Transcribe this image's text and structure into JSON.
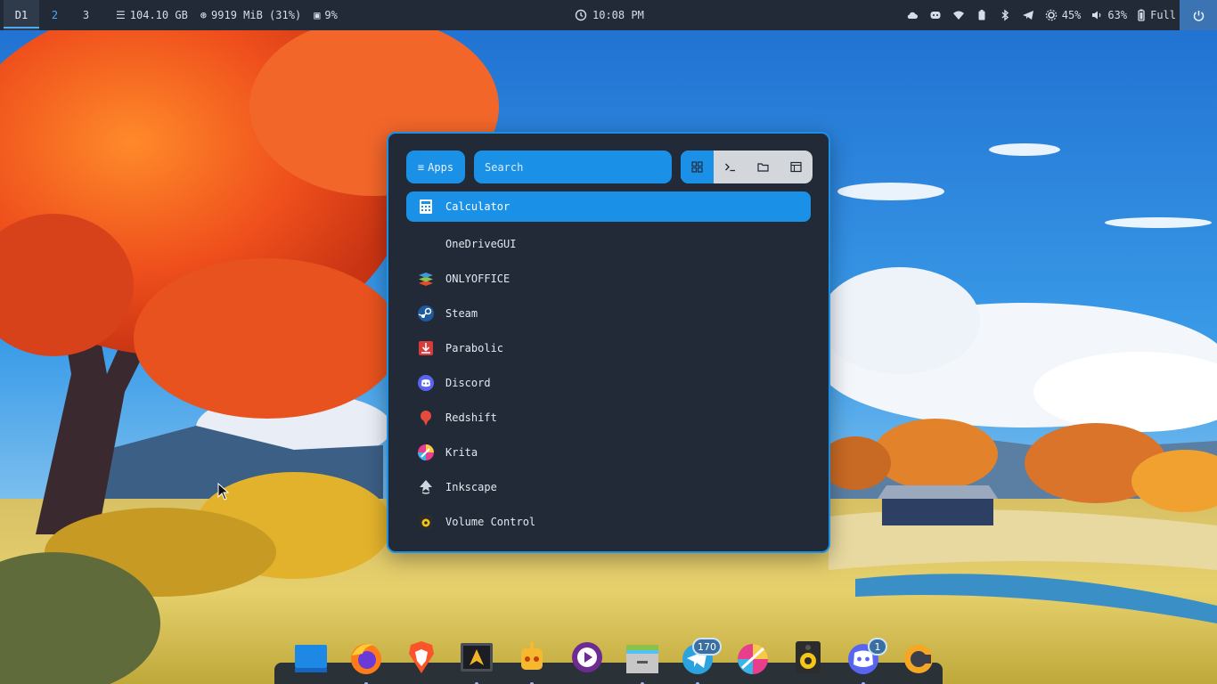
{
  "topbar": {
    "workspaces": [
      "D1",
      "2",
      "3"
    ],
    "disk": "104.10 GB",
    "memory": "9919 MiB (31%)",
    "cpu": "9%",
    "clock": "10:08 PM",
    "brightness": "45%",
    "volume": "63%",
    "battery": "Full",
    "tray_icons": [
      "cloud-icon",
      "discord-tray-icon",
      "wifi-icon",
      "battery-icon",
      "bluetooth-icon",
      "telegram-tray-icon"
    ]
  },
  "launcher": {
    "apps_label": "Apps",
    "search_placeholder": "Search",
    "modes": [
      "grid-icon",
      "terminal-icon",
      "folder-icon",
      "window-icon"
    ],
    "items": [
      {
        "label": "Calculator",
        "icon": "calculator-icon"
      },
      {
        "label": "OneDriveGUI",
        "icon": ""
      },
      {
        "label": "ONLYOFFICE",
        "icon": "onlyoffice-icon"
      },
      {
        "label": "Steam",
        "icon": "steam-icon"
      },
      {
        "label": "Parabolic",
        "icon": "parabolic-icon"
      },
      {
        "label": "Discord",
        "icon": "discord-icon"
      },
      {
        "label": "Redshift",
        "icon": "redshift-icon"
      },
      {
        "label": "Krita",
        "icon": "krita-icon"
      },
      {
        "label": "Inkscape",
        "icon": "inkscape-icon"
      },
      {
        "label": "Volume Control",
        "icon": "volume-control-icon"
      }
    ]
  },
  "dock": {
    "items": [
      {
        "name": "desktop",
        "icon": "desktop-icon"
      },
      {
        "name": "firefox",
        "icon": "firefox-icon"
      },
      {
        "name": "brave",
        "icon": "brave-icon"
      },
      {
        "name": "arch",
        "icon": "arch-terminal-icon"
      },
      {
        "name": "robot",
        "icon": "robot-icon"
      },
      {
        "name": "player",
        "icon": "media-player-icon"
      },
      {
        "name": "files",
        "icon": "file-manager-icon"
      },
      {
        "name": "telegram",
        "icon": "telegram-icon",
        "badge": "170"
      },
      {
        "name": "krita",
        "icon": "krita-dock-icon"
      },
      {
        "name": "speaker",
        "icon": "speaker-icon"
      },
      {
        "name": "discord",
        "icon": "discord-dock-icon",
        "badge": "1"
      },
      {
        "name": "ccleaner",
        "icon": "cleaner-icon"
      }
    ]
  }
}
